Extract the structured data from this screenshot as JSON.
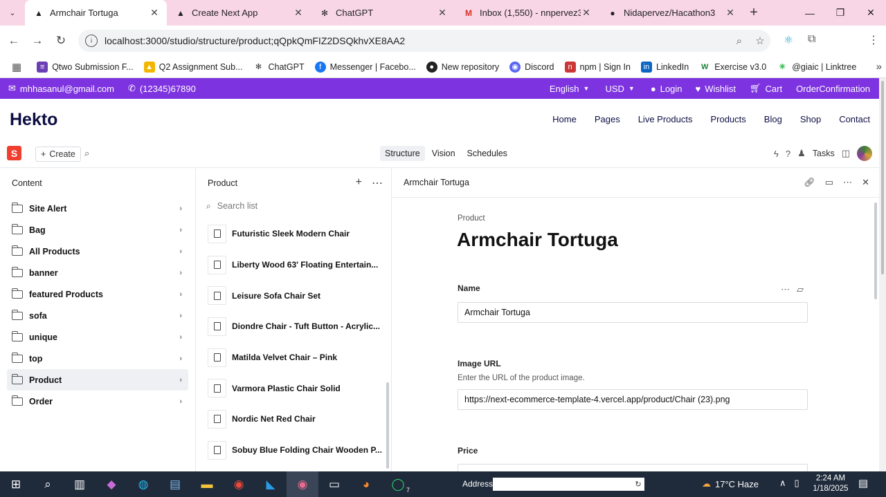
{
  "browser": {
    "tabs": [
      {
        "title": "Armchair Tortuga",
        "icon": "vercel-triangle-icon",
        "active": true
      },
      {
        "title": "Create Next App",
        "icon": "vercel-triangle-icon",
        "active": false
      },
      {
        "title": "ChatGPT",
        "icon": "chatgpt-icon",
        "active": false
      },
      {
        "title": "Inbox (1,550) - nnpervez333",
        "icon": "gmail-icon",
        "active": false
      },
      {
        "title": "Nidapervez/Hacathon3",
        "icon": "github-icon",
        "active": false
      }
    ],
    "url": "localhost:3000/studio/structure/product;qQpkQmFIZ2DSQkhvXE8AA2",
    "bookmarks": [
      {
        "label": "Qtwo Submission F...",
        "color": "#6a3fb5"
      },
      {
        "label": "Q2 Assignment Sub...",
        "color": "#1e8e3e"
      },
      {
        "label": "ChatGPT",
        "color": "#444444"
      },
      {
        "label": "Messenger | Facebo...",
        "color": "#1877f2"
      },
      {
        "label": "New repository",
        "color": "#222222"
      },
      {
        "label": "Discord",
        "color": "#5865f2"
      },
      {
        "label": "npm | Sign In",
        "color": "#cb3837"
      },
      {
        "label": "LinkedIn",
        "color": "#0a66c2"
      },
      {
        "label": "Exercise v3.0",
        "color": "#1a7f37"
      },
      {
        "label": "@giaic | Linktree",
        "color": "#43e55e"
      }
    ]
  },
  "site": {
    "email": "mhhasanul@gmail.com",
    "phone": "(12345)67890",
    "language": "English",
    "currency": "USD",
    "login": "Login",
    "wishlist": "Wishlist",
    "cart": "Cart",
    "order": "OrderConfirmation",
    "logo": "Hekto",
    "nav": [
      "Home",
      "Pages",
      "Live Products",
      "Products",
      "Blog",
      "Shop",
      "Contact"
    ]
  },
  "studio": {
    "logo_letter": "S",
    "create_label": "Create",
    "tabs": [
      "Structure",
      "Vision",
      "Schedules"
    ],
    "tasks_label": "Tasks",
    "content": {
      "title": "Content",
      "items": [
        "Site Alert",
        "Bag",
        "All Products",
        "banner",
        "featured Products",
        "sofa",
        "unique",
        "top",
        "Product",
        "Order"
      ]
    },
    "list": {
      "title": "Product",
      "search_placeholder": "Search list",
      "items": [
        "Futuristic Sleek Modern Chair",
        "Liberty Wood 63' Floating Entertain...",
        "Leisure Sofa Chair Set",
        "Diondre Chair - Tuft Button - Acrylic...",
        "Matilda Velvet Chair – Pink",
        "Varmora Plastic Chair Solid",
        "Nordic Net Red Chair",
        "Sobuy Blue Folding Chair Wooden P..."
      ]
    },
    "document": {
      "header": "Armchair Tortuga",
      "type": "Product",
      "title": "Armchair Tortuga",
      "name_label": "Name",
      "name_value": "Armchair Tortuga",
      "image_label": "Image URL",
      "image_desc": "Enter the URL of the product image.",
      "image_value": "https://next-ecommerce-template-4.vercel.app/product/Chair (23).png",
      "price_label": "Price"
    }
  },
  "taskbar": {
    "address_label": "Address",
    "weather": "17°C  Haze",
    "time": "2:24 AM",
    "date": "1/18/2025",
    "whatsapp_badge": "7"
  },
  "colors": {
    "accent_purple": "#7e33e0",
    "sanity_red": "#f03e2f",
    "tab_bg": "#f9d6e6"
  }
}
